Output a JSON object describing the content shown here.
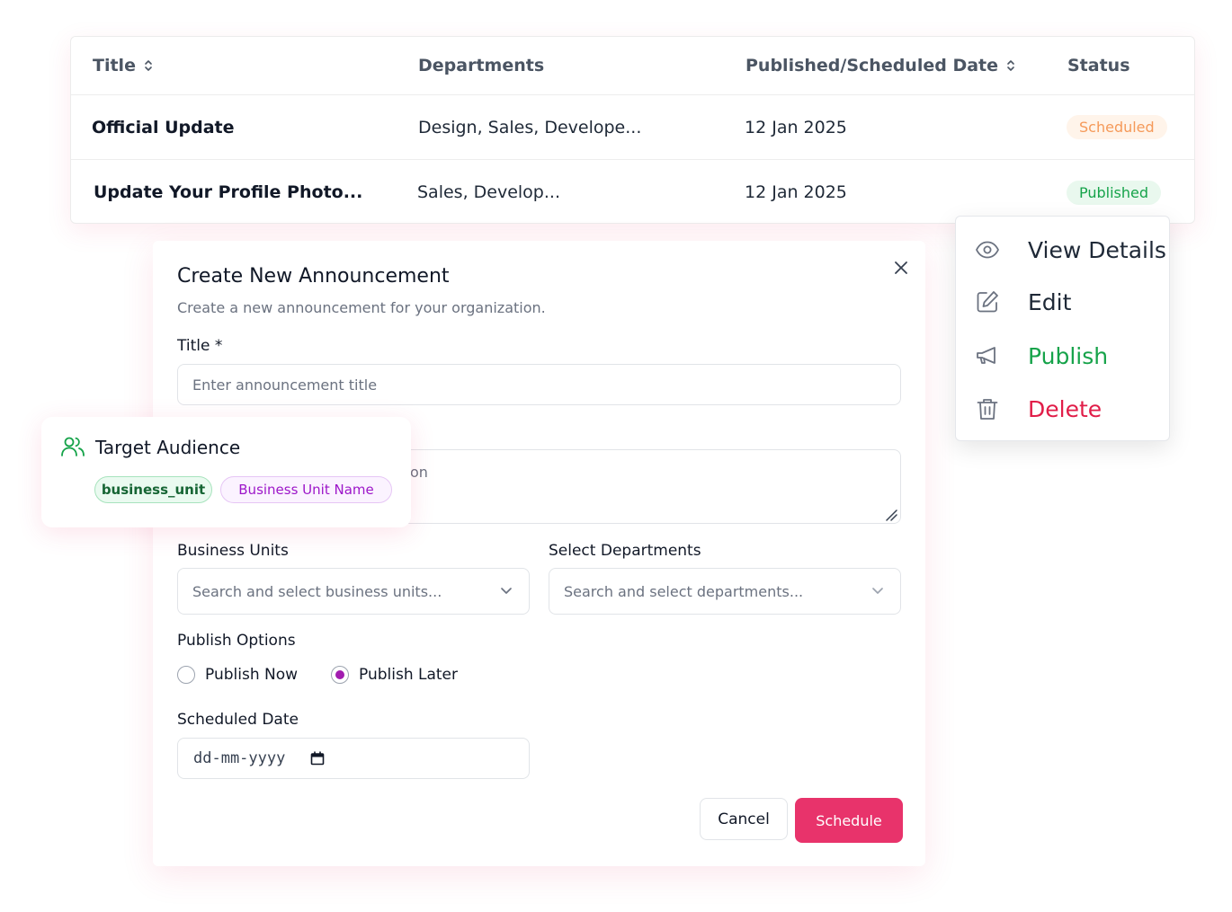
{
  "table": {
    "headers": {
      "title": "Title",
      "departments": "Departments",
      "date": "Published/Scheduled Date",
      "status": "Status"
    },
    "rows": [
      {
        "title": "Official Update",
        "departments": "Design, Sales, Develope...",
        "date": "12 Jan 2025",
        "status": "Scheduled"
      },
      {
        "title": "Update Your Profile Photo...",
        "departments": "Sales, Develop...",
        "date": "12 Jan 2025",
        "status": "Published"
      }
    ]
  },
  "dialog": {
    "title": "Create New Announcement",
    "subtitle": "Create a new announcement for your organization.",
    "title_label": "Title *",
    "title_placeholder": "Enter announcement title",
    "description_visible_fragment": "on",
    "business_units_label": "Business Units",
    "business_units_placeholder": "Search and select business units...",
    "departments_label": "Select Departments",
    "departments_placeholder": "Search and select departments...",
    "publish_options_label": "Publish Options",
    "publish_now_label": "Publish Now",
    "publish_later_label": "Publish Later",
    "publish_option_selected": "Publish Later",
    "scheduled_date_label": "Scheduled Date",
    "scheduled_date_placeholder": "dd-mm-yyyy",
    "cancel_label": "Cancel",
    "schedule_label": "Schedule"
  },
  "audience": {
    "title": "Target Audience",
    "chips": [
      "business_unit",
      "Business Unit Name"
    ]
  },
  "menu": {
    "items": [
      {
        "label": "View Details",
        "icon": "eye-icon",
        "color": "#1f2937"
      },
      {
        "label": "Edit",
        "icon": "edit-icon",
        "color": "#1f2937"
      },
      {
        "label": "Publish",
        "icon": "megaphone-icon",
        "color": "#16a34a"
      },
      {
        "label": "Delete",
        "icon": "trash-icon",
        "color": "#e11d48"
      }
    ]
  },
  "colors": {
    "accent": "#e8336b",
    "radio_selected": "#a21caf",
    "scheduled": "#f59a5a",
    "published": "#16a34a",
    "delete": "#e11d48"
  }
}
